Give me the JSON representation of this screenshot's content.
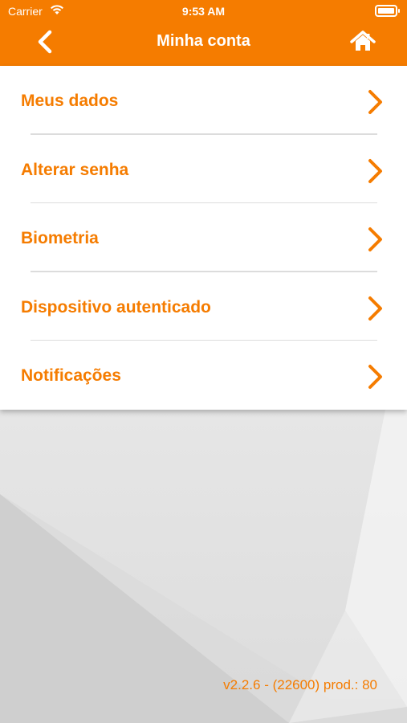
{
  "status_bar": {
    "carrier": "Carrier",
    "time": "9:53 AM"
  },
  "nav": {
    "title": "Minha conta",
    "back_icon": "chevron-left-icon",
    "home_icon": "home-icon"
  },
  "menu": {
    "items": [
      {
        "label": "Meus dados"
      },
      {
        "label": "Alterar senha"
      },
      {
        "label": "Biometria"
      },
      {
        "label": "Dispositivo autenticado"
      },
      {
        "label": "Notificações"
      }
    ]
  },
  "footer": {
    "version": "v2.2.6 - (22600) prod.: 80"
  },
  "colors": {
    "accent": "#f57c00",
    "background": "#e9e9e9",
    "menu_background": "#ffffff"
  }
}
